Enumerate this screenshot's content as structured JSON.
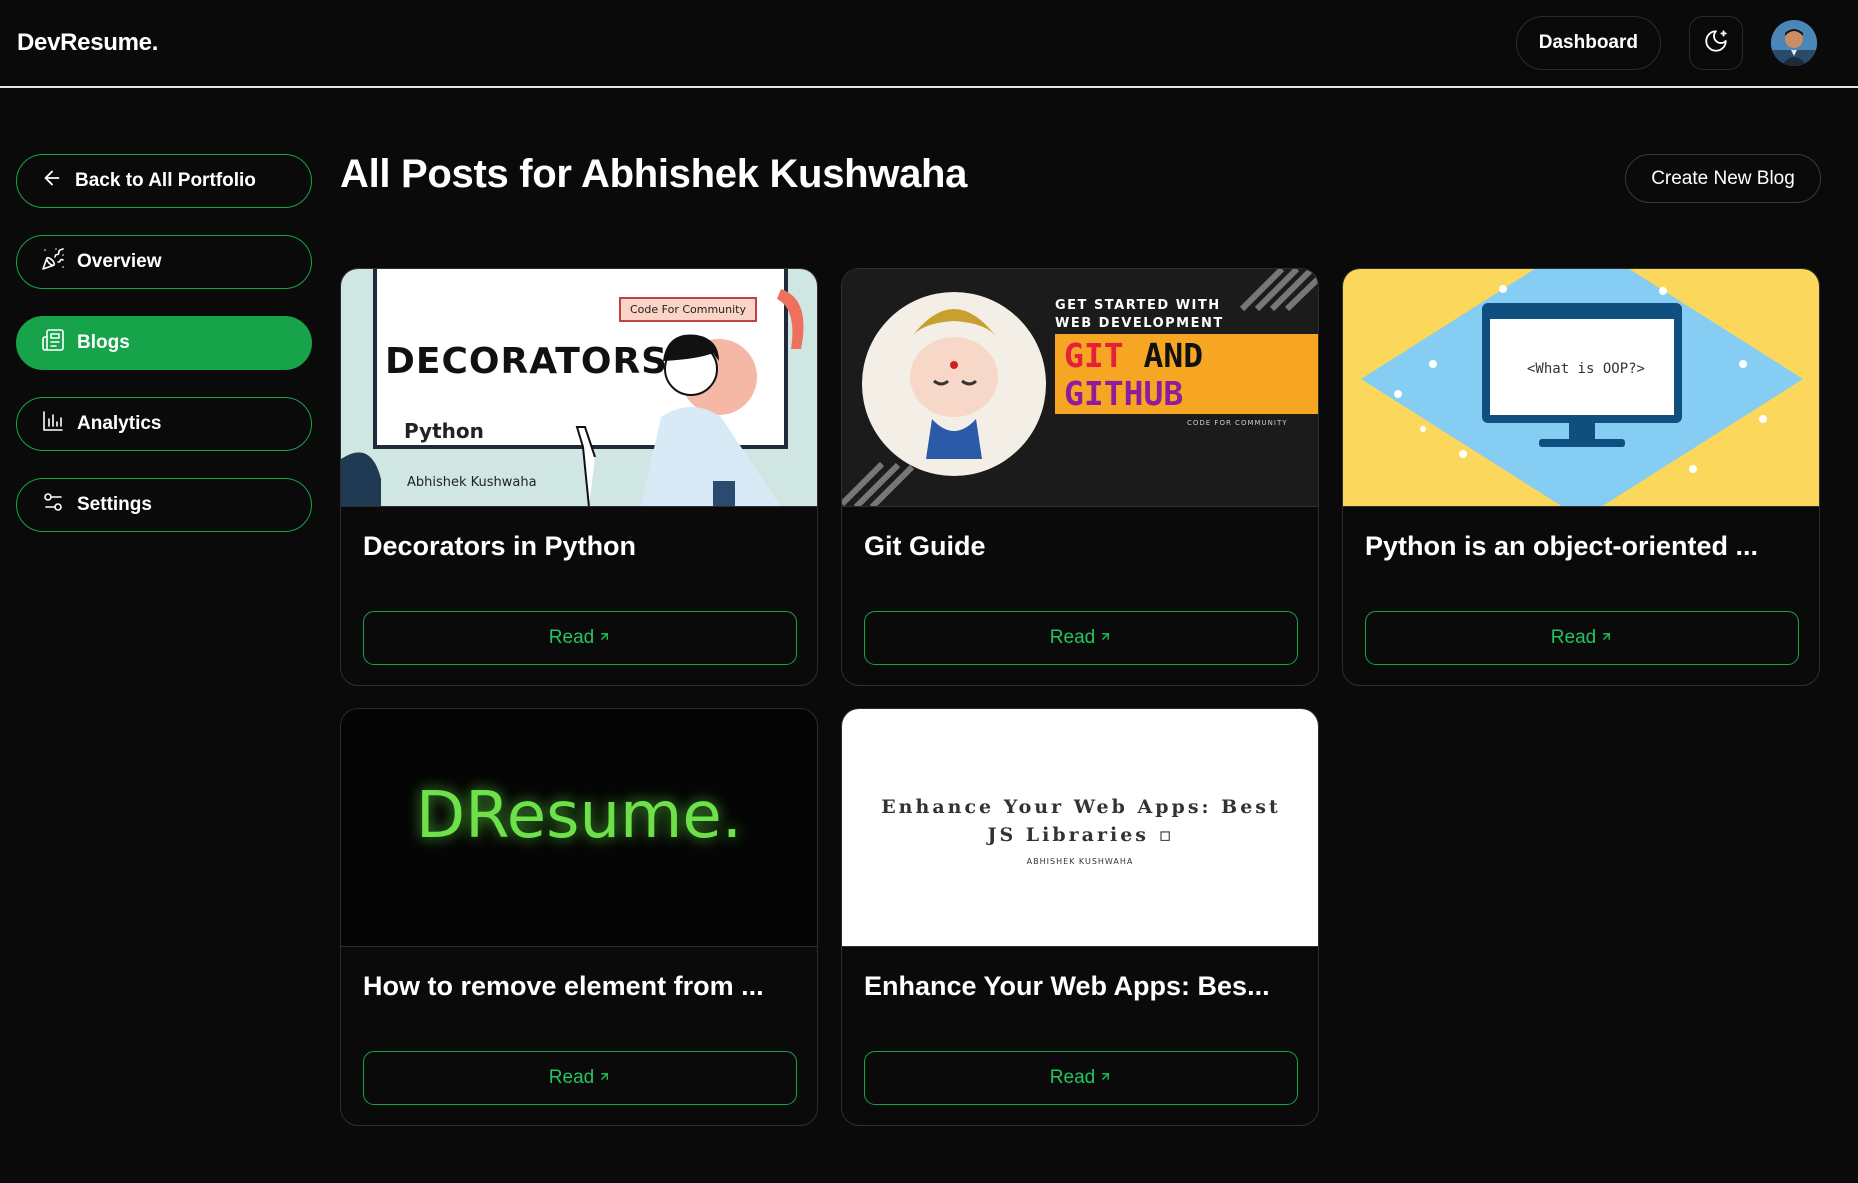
{
  "header": {
    "brand": "DevResume.",
    "dashboard_label": "Dashboard",
    "theme_icon": "moon-icon"
  },
  "sidebar": {
    "items": [
      {
        "label": "Back to All Portfolio",
        "icon": "arrow-left-icon",
        "active": false
      },
      {
        "label": "Overview",
        "icon": "party-popper-icon",
        "active": false
      },
      {
        "label": "Blogs",
        "icon": "newspaper-icon",
        "active": true
      },
      {
        "label": "Analytics",
        "icon": "bar-chart-icon",
        "active": false
      },
      {
        "label": "Settings",
        "icon": "sliders-icon",
        "active": false
      }
    ]
  },
  "main": {
    "title": "All Posts for Abhishek Kushwaha",
    "create_label": "Create New Blog",
    "read_label": "Read",
    "posts": [
      {
        "title": "Decorators in Python",
        "thumb": {
          "badge": "Code For Community",
          "heading": "DECORATORS",
          "sub": "Python",
          "author": "Abhishek Kushwaha"
        }
      },
      {
        "title": "Git Guide",
        "thumb": {
          "line1": "GET STARTED WITH",
          "line2": "WEB DEVELOPMENT",
          "git": "GIT",
          "and": "AND",
          "github": "GITHUB",
          "footer": "CODE FOR COMMUNITY"
        }
      },
      {
        "title": "Python is an object-oriented ...",
        "thumb": {
          "screen_text": "<What is OOP?>"
        }
      },
      {
        "title": "How to remove element from ...",
        "thumb": {
          "logo": "DResume."
        }
      },
      {
        "title": "Enhance Your Web Apps: Bes...",
        "thumb": {
          "heading": "Enhance Your Web Apps: Best JS Libraries ▫",
          "author": "ABHISHEK KUSHWAHA"
        }
      }
    ]
  },
  "colors": {
    "accent": "#16a34a",
    "accent_text": "#22c55e",
    "background": "#0a0a0a"
  }
}
